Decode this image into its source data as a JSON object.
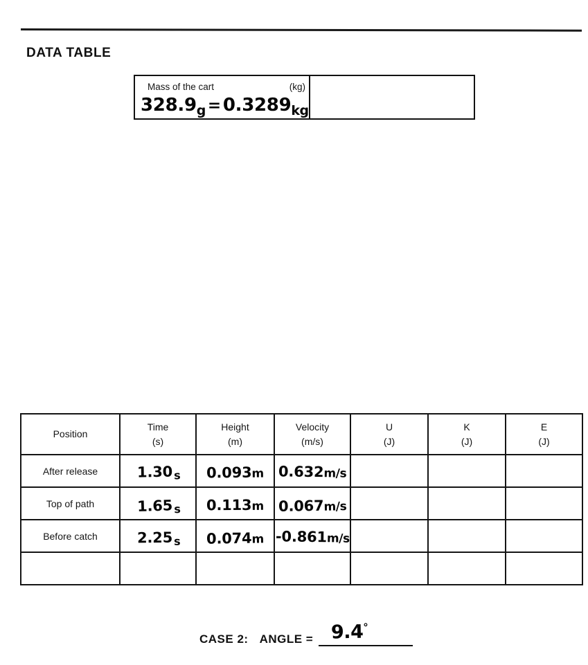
{
  "document": {
    "section_heading": "DATA TABLE"
  },
  "mass_table": {
    "label": "Mass of the cart",
    "unit": "(kg)",
    "handwritten": {
      "grams_value": "328.9",
      "grams_unit": "g",
      "equals": "=",
      "kg_value": "0.3289",
      "kg_unit": "kg",
      "full_text": "328.9g = 0.3289kg"
    },
    "blank_cell_value": ""
  },
  "data_table": {
    "columns": [
      {
        "name": "Position",
        "unit": ""
      },
      {
        "name": "Time",
        "unit": "(s)"
      },
      {
        "name": "Height",
        "unit": "(m)"
      },
      {
        "name": "Velocity",
        "unit": "(m/s)"
      },
      {
        "name": "U",
        "unit": "(J)"
      },
      {
        "name": "K",
        "unit": "(J)"
      },
      {
        "name": "E",
        "unit": "(J)"
      }
    ],
    "rows": [
      {
        "position": "After release",
        "time_value": "1.30",
        "time_unit": "s",
        "height_value": "0.093",
        "height_unit": "m",
        "velocity_value": "0.632",
        "velocity_unit": "m/s",
        "u": "",
        "k": "",
        "e": ""
      },
      {
        "position": "Top of path",
        "time_value": "1.65",
        "time_unit": "s",
        "height_value": "0.113",
        "height_unit": "m",
        "velocity_value": "0.067",
        "velocity_unit": "m/s",
        "u": "",
        "k": "",
        "e": ""
      },
      {
        "position": "Before catch",
        "time_value": "2.25",
        "time_unit": "s",
        "height_value": "0.074",
        "height_unit": "m",
        "velocity_value": "-0.861",
        "velocity_unit": "m/s",
        "u": "",
        "k": "",
        "e": ""
      },
      {
        "position": "",
        "time_value": "",
        "time_unit": "",
        "height_value": "",
        "height_unit": "",
        "velocity_value": "",
        "velocity_unit": "",
        "u": "",
        "k": "",
        "e": ""
      }
    ]
  },
  "footer": {
    "case_label": "CASE 2:",
    "angle_label": "ANGLE =",
    "angle_value": "9.4",
    "angle_degree_symbol": "°"
  },
  "colors": {
    "ink": "#060606",
    "print": "#141414",
    "paper": "#ffffff"
  }
}
